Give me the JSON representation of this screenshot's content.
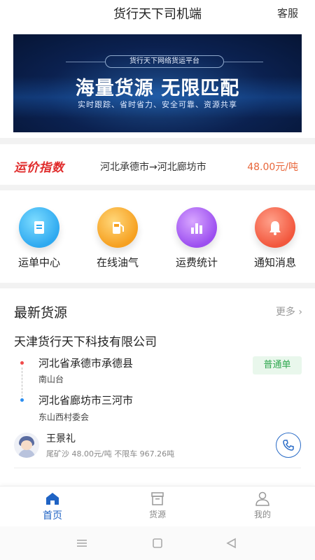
{
  "header": {
    "title": "货行天下司机端",
    "service": "客服"
  },
  "banner": {
    "tag": "货行天下网络货运平台",
    "headline": "海量货源 无限匹配",
    "subtitle": "实时跟踪、省时省力、安全可靠、资源共享"
  },
  "freight_index": {
    "logo": "运价指数",
    "route": "河北承德市→河北廊坊市",
    "price": "48.00元/吨"
  },
  "functions": [
    {
      "label": "运单中心",
      "icon": "document-icon"
    },
    {
      "label": "在线油气",
      "icon": "fuel-pump-icon"
    },
    {
      "label": "运费统计",
      "icon": "bar-chart-icon"
    },
    {
      "label": "通知消息",
      "icon": "bell-icon"
    }
  ],
  "cargo": {
    "title": "最新货源",
    "more": "更多",
    "company": "天津货行天下科技有限公司",
    "from_main": "河北省承德市承德县",
    "from_sub": "南山台",
    "to_main": "河北省廊坊市三河市",
    "to_sub": "东山西村委会",
    "badge": "普通单",
    "driver": "王景礼",
    "detail": "尾矿沙 48.00元/吨 不限车 967.26吨"
  },
  "nav": [
    {
      "label": "首页",
      "active": true
    },
    {
      "label": "货源",
      "active": false
    },
    {
      "label": "我的",
      "active": false
    }
  ],
  "colors": {
    "accent": "#1f63c4",
    "price": "#e8663a",
    "badge_green": "#2fa84f",
    "logo_red": "#e02b2b"
  }
}
